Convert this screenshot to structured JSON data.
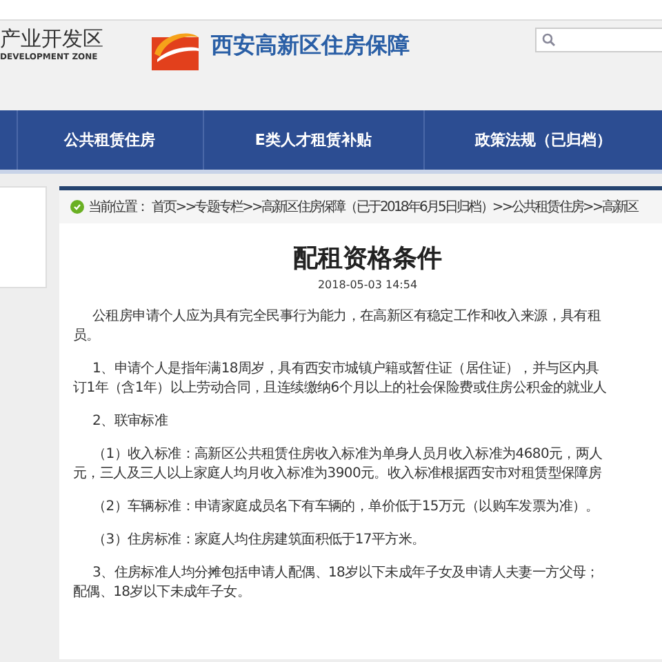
{
  "header": {
    "zone_name": "产业开发区",
    "zone_name_en": "DEVELOPMENT ZONE",
    "site_title": "西安高新区住房保障"
  },
  "nav": [
    {
      "label": "公共租赁住房"
    },
    {
      "label": "E类人才租赁补贴"
    },
    {
      "label": "政策法规（已归档）"
    }
  ],
  "breadcrumb": {
    "label": "当前位置：",
    "path": "首页>>专题专栏>>高新区住房保障（已于2018年6月5日归档）>>公共租赁住房>>高新区"
  },
  "article": {
    "title": "配租资格条件",
    "date": "2018-05-03 14:54",
    "paragraphs": [
      {
        "lines": [
          "公租房申请个人应为具有完全民事行为能力，在高新区有稳定工作和收入来源，具有租",
          "员。"
        ]
      },
      {
        "lines": [
          "1、申请个人是指年满18周岁，具有西安市城镇户籍或暂住证（居住证），并与区内具",
          "订1年（含1年）以上劳动合同，且连续缴纳6个月以上的社会保险费或住房公积金的就业人"
        ]
      },
      {
        "lines": [
          "2、联审标准"
        ]
      },
      {
        "lines": [
          "（1）收入标准：高新区公共租赁住房收入标准为单身人员月收入标准为4680元，两人",
          "元，三人及三人以上家庭人均月收入标准为3900元。收入标准根据西安市对租赁型保障房"
        ]
      },
      {
        "lines": [
          "（2）车辆标准：申请家庭成员名下有车辆的，单价低于15万元（以购车发票为准）。"
        ]
      },
      {
        "lines": [
          "（3）住房标准：家庭人均住房建筑面积低于17平方米。"
        ]
      },
      {
        "lines": [
          "3、住房标准人均分摊包括申请人配偶、18岁以下未成年子女及申请人夫妻一方父母；",
          "配偶、18岁以下未成年子女。"
        ]
      }
    ]
  }
}
